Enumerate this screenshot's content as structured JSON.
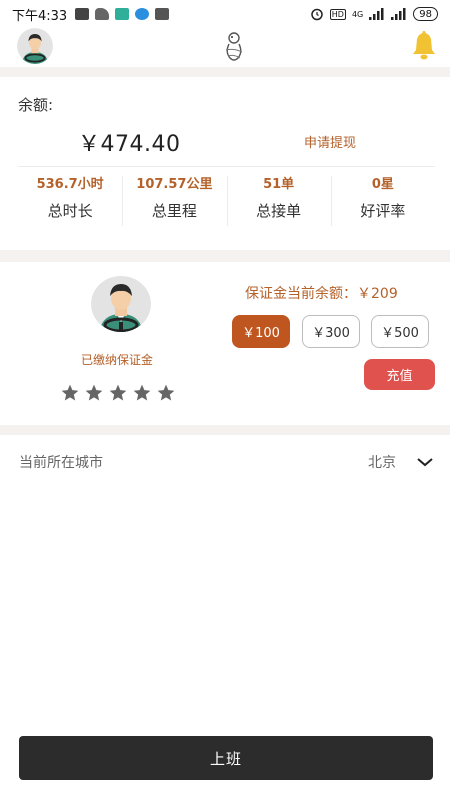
{
  "status_bar": {
    "time": "下午4:33",
    "network": "4G",
    "battery": "98"
  },
  "header": {
    "avatar_icon": "driver-avatar-icon",
    "logo_icon": "brand-logo-icon",
    "notification_icon": "bell-icon"
  },
  "balance": {
    "label": "余额:",
    "amount": "￥474.40",
    "withdraw_label": "申请提现"
  },
  "stats": [
    {
      "value": "536.7小时",
      "label": "总时长"
    },
    {
      "value": "107.57公里",
      "label": "总里程"
    },
    {
      "value": "51单",
      "label": "总接单"
    },
    {
      "value": "0星",
      "label": "好评率"
    }
  ],
  "deposit": {
    "status": "已缴纳保证金",
    "rating_stars": 5,
    "balance_text": "保证金当前余额：￥209",
    "amounts": [
      "￥100",
      "￥300",
      "￥500"
    ],
    "selected_amount": "￥100",
    "recharge_label": "充值"
  },
  "city": {
    "label": "当前所在城市",
    "value": "北京"
  },
  "start_work_label": "上班",
  "colors": {
    "accent": "#b4612a",
    "selected": "#c0561f",
    "recharge": "#e0524e",
    "bell": "#f1c232",
    "primary_button": "#2c2c2c",
    "band": "#f4f1ee"
  }
}
